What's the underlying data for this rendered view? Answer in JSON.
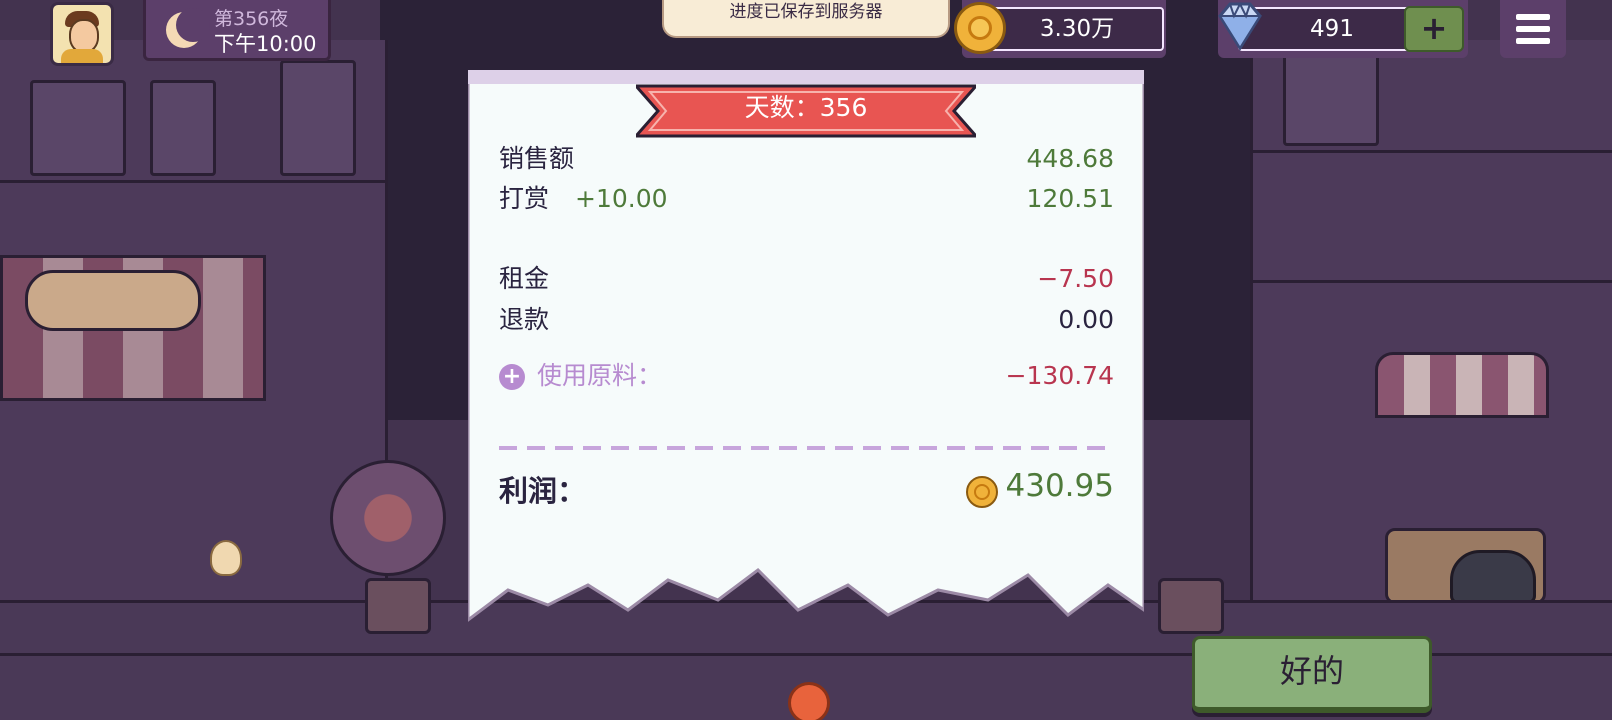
{
  "hud": {
    "day_label": "第356夜",
    "time": "下午10:00",
    "save_toast": "进度已保存到服务器",
    "coins": "3.30万",
    "gems": "491",
    "add_label": "+"
  },
  "receipt": {
    "title": "天数：356",
    "sales_label": "销售额",
    "sales_value": "448.68",
    "tips_label": "打赏",
    "tips_bonus": "+10.00",
    "tips_value": "120.51",
    "rent_label": "租金",
    "rent_value": "−7.50",
    "refund_label": "退款",
    "refund_value": "0.00",
    "materials_label": "使用原料：",
    "materials_value": "−130.74",
    "profit_label": "利润：",
    "profit_value": "430.95"
  },
  "ok_label": "好的",
  "colors": {
    "positive": "#4e7a3a",
    "negative": "#b8354f",
    "ribbon": "#e85552",
    "panel": "#5c3f6a"
  }
}
